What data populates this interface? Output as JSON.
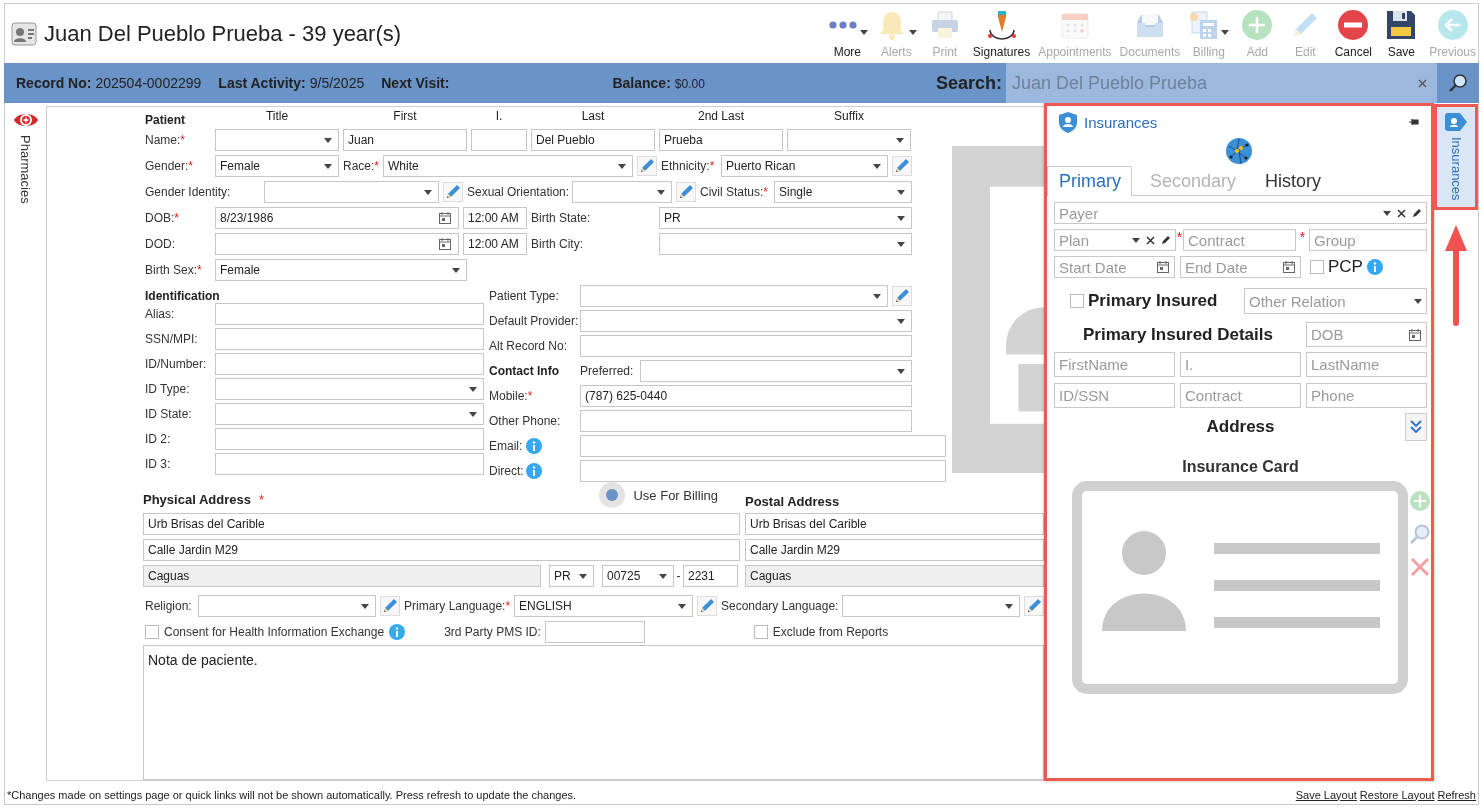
{
  "window": {
    "title": "Juan Del Pueblo Prueba - 39 year(s)"
  },
  "toolbar": [
    {
      "kind": "more",
      "label": "More",
      "disabled": false,
      "dropdown": true
    },
    {
      "kind": "alerts",
      "label": "Alerts",
      "disabled": true,
      "dropdown": true
    },
    {
      "kind": "print",
      "label": "Print",
      "disabled": true,
      "dropdown": false
    },
    {
      "kind": "signatures",
      "label": "Signatures",
      "disabled": false,
      "dropdown": false
    },
    {
      "kind": "appointments",
      "label": "Appointments",
      "disabled": true,
      "dropdown": false
    },
    {
      "kind": "documents",
      "label": "Documents",
      "disabled": true,
      "dropdown": false
    },
    {
      "kind": "billing",
      "label": "Billing",
      "disabled": true,
      "dropdown": true
    },
    {
      "kind": "add",
      "label": "Add",
      "disabled": true,
      "dropdown": false
    },
    {
      "kind": "edit",
      "label": "Edit",
      "disabled": true,
      "dropdown": false
    },
    {
      "kind": "cancel",
      "label": "Cancel",
      "disabled": false,
      "dropdown": false
    },
    {
      "kind": "save",
      "label": "Save",
      "disabled": false,
      "dropdown": false
    },
    {
      "kind": "previous",
      "label": "Previous",
      "disabled": true,
      "dropdown": false
    }
  ],
  "info_bar": [
    {
      "label": "Record No:",
      "value": "202504-0002299"
    },
    {
      "label": "Last Activity:",
      "value": "9/5/2025"
    },
    {
      "label": "Next Visit:"
    },
    {
      "label": "Balance:",
      "value": "$0.00"
    }
  ],
  "search": {
    "label": "Search:",
    "placeholder": "Juan Del Pueblo Prueba"
  },
  "left_tabs": [
    {
      "label": "Pharmacies",
      "selected": false
    }
  ],
  "right_tabs": [
    {
      "label": "Insurances",
      "selected": true
    }
  ],
  "patient": {
    "heading": "Patient",
    "column_headings": [
      "Title",
      "First",
      "I.",
      "Last",
      "2nd Last",
      "Suffix"
    ],
    "lines": [
      [
        {
          "kind": "label",
          "text": "Name:",
          "required_mark": "*"
        },
        {
          "kind": "select"
        },
        {
          "kind": "text",
          "value": "Juan"
        },
        {
          "kind": "text"
        },
        {
          "kind": "text",
          "value": "Del Pueblo"
        },
        {
          "kind": "text",
          "value": "Prueba"
        },
        {
          "kind": "select"
        }
      ],
      [
        {
          "kind": "label",
          "text": "Gender:",
          "required_mark": "*"
        },
        {
          "kind": "select",
          "value": "Female"
        },
        {
          "kind": "label",
          "text": "Race:",
          "required_mark": "*"
        },
        {
          "kind": "select",
          "value": "White"
        },
        {
          "kind": "edit"
        },
        {
          "kind": "label",
          "text": "Ethnicity:",
          "required_mark": "*"
        },
        {
          "kind": "select",
          "value": "Puerto Rican"
        },
        {
          "kind": "edit"
        }
      ],
      [
        {
          "kind": "label",
          "text": "Gender Identity:"
        },
        {
          "kind": "select"
        },
        {
          "kind": "edit"
        },
        {
          "kind": "label",
          "text": "Sexual Orientation:"
        },
        {
          "kind": "select"
        },
        {
          "kind": "edit"
        },
        {
          "kind": "label",
          "text": "Civil Status:",
          "required_mark": "*"
        },
        {
          "kind": "select",
          "value": "Single"
        }
      ],
      [
        {
          "kind": "label",
          "text": "DOB:",
          "required_mark": "*"
        },
        {
          "kind": "date",
          "value": "8/23/1986"
        },
        {
          "kind": "time",
          "value": "12:00 AM"
        },
        {
          "kind": "label",
          "text": "Birth State:"
        },
        {
          "kind": "select",
          "value": "PR"
        }
      ],
      [
        {
          "kind": "label",
          "text": "DOD:"
        },
        {
          "kind": "date"
        },
        {
          "kind": "time",
          "value": "12:00 AM"
        },
        {
          "kind": "label",
          "text": "Birth City:"
        },
        {
          "kind": "select"
        }
      ],
      [
        {
          "kind": "label",
          "text": "Birth Sex:",
          "required_mark": "*"
        },
        {
          "kind": "select",
          "value": "Female"
        }
      ]
    ]
  },
  "identification": {
    "heading": "Identification",
    "lines": [
      [
        {
          "kind": "label",
          "text": "Alias:"
        },
        {
          "kind": "text"
        }
      ],
      [
        {
          "kind": "label",
          "text": "SSN/MPI:"
        },
        {
          "kind": "text"
        }
      ],
      [
        {
          "kind": "label",
          "text": "ID/Number:"
        },
        {
          "kind": "text"
        }
      ],
      [
        {
          "kind": "label",
          "text": "ID Type:"
        },
        {
          "kind": "select"
        }
      ],
      [
        {
          "kind": "label",
          "text": "ID State:"
        },
        {
          "kind": "select"
        }
      ],
      [
        {
          "kind": "label",
          "text": "ID 2:"
        },
        {
          "kind": "text"
        }
      ],
      [
        {
          "kind": "label",
          "text": "ID 3:"
        },
        {
          "kind": "text"
        }
      ]
    ]
  },
  "details": {
    "lines": [
      [
        {
          "kind": "label",
          "text": "Patient Type:"
        },
        {
          "kind": "select"
        },
        {
          "kind": "edit"
        }
      ],
      [
        {
          "kind": "label",
          "text": "Default Provider:"
        },
        {
          "kind": "select"
        }
      ],
      [
        {
          "kind": "label",
          "text": "Alt Record No:"
        },
        {
          "kind": "text"
        }
      ],
      [
        {
          "kind": "heading",
          "text": "Contact Info"
        },
        {
          "kind": "label",
          "text": "Preferred:"
        },
        {
          "kind": "select"
        }
      ],
      [
        {
          "kind": "label",
          "text": "Mobile:",
          "required_mark": "*"
        },
        {
          "kind": "text",
          "value": "(787) 625-0440"
        }
      ],
      [
        {
          "kind": "label",
          "text": "Other Phone:"
        },
        {
          "kind": "text"
        }
      ],
      [
        {
          "kind": "label",
          "text": "Email:"
        },
        {
          "kind": "info"
        },
        {
          "kind": "text"
        }
      ],
      [
        {
          "kind": "label",
          "text": "Direct:"
        },
        {
          "kind": "info"
        },
        {
          "kind": "text"
        }
      ]
    ]
  },
  "address": {
    "physical": {
      "heading": "Physical Address",
      "required_mark": "*",
      "lines": [
        "Urb Brisas del Carible",
        "Calle Jardin M29"
      ],
      "city": {
        "value": "Caguas",
        "disabled": true
      },
      "state": "PR",
      "zip": "00725",
      "zip_separator": "-",
      "zip_ext": "2231"
    },
    "use_for_billing": {
      "label": "Use For Billing",
      "selected": true
    },
    "postal": {
      "heading": "Postal Address",
      "lines": [
        "Urb Brisas del Carible",
        "Calle Jardin M29"
      ],
      "city": {
        "value": "Caguas",
        "disabled": true
      }
    }
  },
  "languages_row": [
    {
      "kind": "label",
      "text": "Religion:"
    },
    {
      "kind": "select"
    },
    {
      "kind": "edit"
    },
    {
      "kind": "label",
      "text": "Primary Language:",
      "required_mark": "*"
    },
    {
      "kind": "select",
      "value": "ENGLISH"
    },
    {
      "kind": "edit"
    },
    {
      "kind": "label",
      "text": "Secondary Language:"
    },
    {
      "kind": "select"
    },
    {
      "kind": "edit"
    }
  ],
  "options_row": [
    {
      "kind": "checkbox",
      "label": "Consent for Health Information Exchange",
      "checked": false
    },
    {
      "kind": "info"
    },
    {
      "kind": "label",
      "text": "3rd Party PMS ID:"
    },
    {
      "kind": "text"
    },
    {
      "kind": "checkbox",
      "label": "Exclude from Reports",
      "checked": false
    }
  ],
  "notes": {
    "value": "Nota de paciente."
  },
  "insurance": {
    "title": "Insurances",
    "tabs": [
      {
        "label": "Primary",
        "selected": true,
        "disabled": false
      },
      {
        "label": "Secondary",
        "selected": false,
        "disabled": true
      },
      {
        "label": "History",
        "selected": false,
        "disabled": false
      }
    ],
    "payer": {
      "placeholder": "Payer"
    },
    "plan": {
      "placeholder": "Plan"
    },
    "contract": {
      "placeholder": "Contract",
      "required_mark": "*"
    },
    "group": {
      "placeholder": "Group",
      "required_mark": "*"
    },
    "start_date": {
      "placeholder": "Start Date"
    },
    "end_date": {
      "placeholder": "End Date"
    },
    "pcp": {
      "label": "PCP",
      "checked": false
    },
    "primary_insured": {
      "label": "Primary Insured",
      "checked": false
    },
    "relation": {
      "placeholder": "Other Relation"
    },
    "details_heading": "Primary Insured Details",
    "dob": {
      "placeholder": "DOB"
    },
    "insured_fields": [
      {
        "placeholder": "FirstName"
      },
      {
        "placeholder": "I."
      },
      {
        "placeholder": "LastName"
      },
      {
        "placeholder": "ID/SSN"
      },
      {
        "placeholder": "Contract"
      },
      {
        "placeholder": "Phone"
      }
    ],
    "address_heading": "Address",
    "address_expanded": false,
    "card_heading": "Insurance Card"
  },
  "annotations": [
    {
      "kind": "frame"
    },
    {
      "kind": "frame"
    },
    {
      "kind": "arrow"
    }
  ],
  "status_bar": {
    "note": "*Changes made on settings page or quick links will not be shown automatically. Press refresh to update the changes.",
    "links": [
      "Save Layout",
      "Restore Layout",
      "Refresh"
    ]
  }
}
